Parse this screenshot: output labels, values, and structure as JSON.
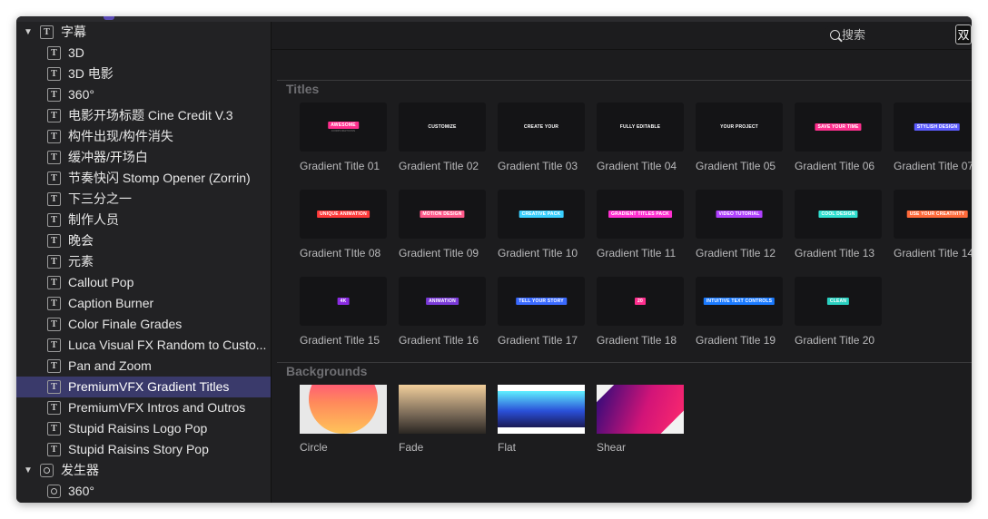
{
  "sidebar": {
    "items": [
      {
        "label": "字幕",
        "level": "top",
        "icon": "title-icon",
        "expanded": true
      },
      {
        "label": "3D",
        "level": "child",
        "icon": "title-icon"
      },
      {
        "label": "3D 电影",
        "level": "child",
        "icon": "title-icon"
      },
      {
        "label": "360°",
        "level": "child",
        "icon": "title-icon"
      },
      {
        "label": "电影开场标题 Cine Credit V.3",
        "level": "child",
        "icon": "title-icon"
      },
      {
        "label": "构件出现/构件消失",
        "level": "child",
        "icon": "title-icon"
      },
      {
        "label": "缓冲器/开场白",
        "level": "child",
        "icon": "title-icon"
      },
      {
        "label": "节奏快闪 Stomp Opener (Zorrin)",
        "level": "child",
        "icon": "title-icon"
      },
      {
        "label": "下三分之一",
        "level": "child",
        "icon": "title-icon"
      },
      {
        "label": "制作人员",
        "level": "child",
        "icon": "title-icon"
      },
      {
        "label": "晚会",
        "level": "child",
        "icon": "title-icon"
      },
      {
        "label": "元素",
        "level": "child",
        "icon": "title-icon"
      },
      {
        "label": "Callout Pop",
        "level": "child",
        "icon": "title-icon"
      },
      {
        "label": "Caption Burner",
        "level": "child",
        "icon": "title-icon"
      },
      {
        "label": "Color Finale Grades",
        "level": "child",
        "icon": "title-icon"
      },
      {
        "label": "Luca Visual FX Random to Custo...",
        "level": "child",
        "icon": "title-icon"
      },
      {
        "label": "Pan and Zoom",
        "level": "child",
        "icon": "title-icon"
      },
      {
        "label": "PremiumVFX Gradient Titles",
        "level": "child",
        "icon": "title-icon",
        "selected": true
      },
      {
        "label": "PremiumVFX Intros and Outros",
        "level": "child",
        "icon": "title-icon"
      },
      {
        "label": "Stupid Raisins Logo Pop",
        "level": "child",
        "icon": "title-icon"
      },
      {
        "label": "Stupid Raisins Story Pop",
        "level": "child",
        "icon": "title-icon"
      },
      {
        "label": "发生器",
        "level": "top",
        "icon": "generator-icon",
        "expanded": true
      },
      {
        "label": "360°",
        "level": "child",
        "icon": "generator-icon"
      }
    ]
  },
  "search": {
    "placeholder": "搜索",
    "value": ""
  },
  "ime_indicator": "双",
  "titles_section": {
    "heading": "Titles",
    "items": [
      {
        "name": "Gradient Title 01",
        "thumb": "AWESOME",
        "thumb_sub": "CORPORATIONS",
        "color": "#ff2f8e"
      },
      {
        "name": "Gradient Title 02",
        "thumb": "CUSTOMIZE",
        "color": "#ffffff"
      },
      {
        "name": "Gradient Title 03",
        "thumb": "CREATE YOUR",
        "color": "#ffffff"
      },
      {
        "name": "Gradient Title 04",
        "thumb": "FULLY EDITABLE",
        "color": "#ffffff"
      },
      {
        "name": "Gradient Title 05",
        "thumb": "YOUR PROJECT",
        "color": "#ffffff"
      },
      {
        "name": "Gradient Title 06",
        "thumb": "SAVE YOUR TIME",
        "color": "#ff2f8e"
      },
      {
        "name": "Gradient Title 07",
        "thumb": "STYLISH DESIGN",
        "color": "#5b5bff"
      },
      {
        "name": "Gradient TItle 08",
        "thumb": "UNIQUE ANIMATION",
        "color": "#ff3a3a"
      },
      {
        "name": "Gradient Title 09",
        "thumb": "MOTION DESIGN",
        "color": "#ff5a8a"
      },
      {
        "name": "Gradient Title 10",
        "thumb": "CREATIVE PACK",
        "color": "#3ad0ff"
      },
      {
        "name": "Gradient Title 11",
        "thumb": "GRADIENT TITLES PACK",
        "color": "#ff2fd0"
      },
      {
        "name": "Gradient Title 12",
        "thumb": "VIDEO TUTORIAL",
        "color": "#b040ff"
      },
      {
        "name": "Gradient Title 13",
        "thumb": "COOL DESIGN",
        "color": "#30e0d0"
      },
      {
        "name": "Gradient Title 14",
        "thumb": "USE YOUR CREATIVITY",
        "color": "#ff6a3a"
      },
      {
        "name": "Gradient Title 15",
        "thumb": "4K",
        "color": "#8a2be2"
      },
      {
        "name": "Gradient Title 16",
        "thumb": "ANIMATION",
        "color": "#7a3ad8"
      },
      {
        "name": "Gradient Title 17",
        "thumb": "TELL YOUR STORY",
        "color": "#3a6aff"
      },
      {
        "name": "Gradient Title 18",
        "thumb": "20",
        "color": "#ff2f8e"
      },
      {
        "name": "Gradient Title 19",
        "thumb": "INTUITIVE TEXT CONTROLS",
        "color": "#1a7aff"
      },
      {
        "name": "Gradient Title 20",
        "thumb": "CLEAN",
        "color": "#2ad0c0"
      }
    ]
  },
  "backgrounds_section": {
    "heading": "Backgrounds",
    "items": [
      {
        "name": "Circle",
        "style": "circle"
      },
      {
        "name": "Fade",
        "style": "fade"
      },
      {
        "name": "Flat",
        "style": "flat"
      },
      {
        "name": "Shear",
        "style": "shear"
      }
    ]
  }
}
